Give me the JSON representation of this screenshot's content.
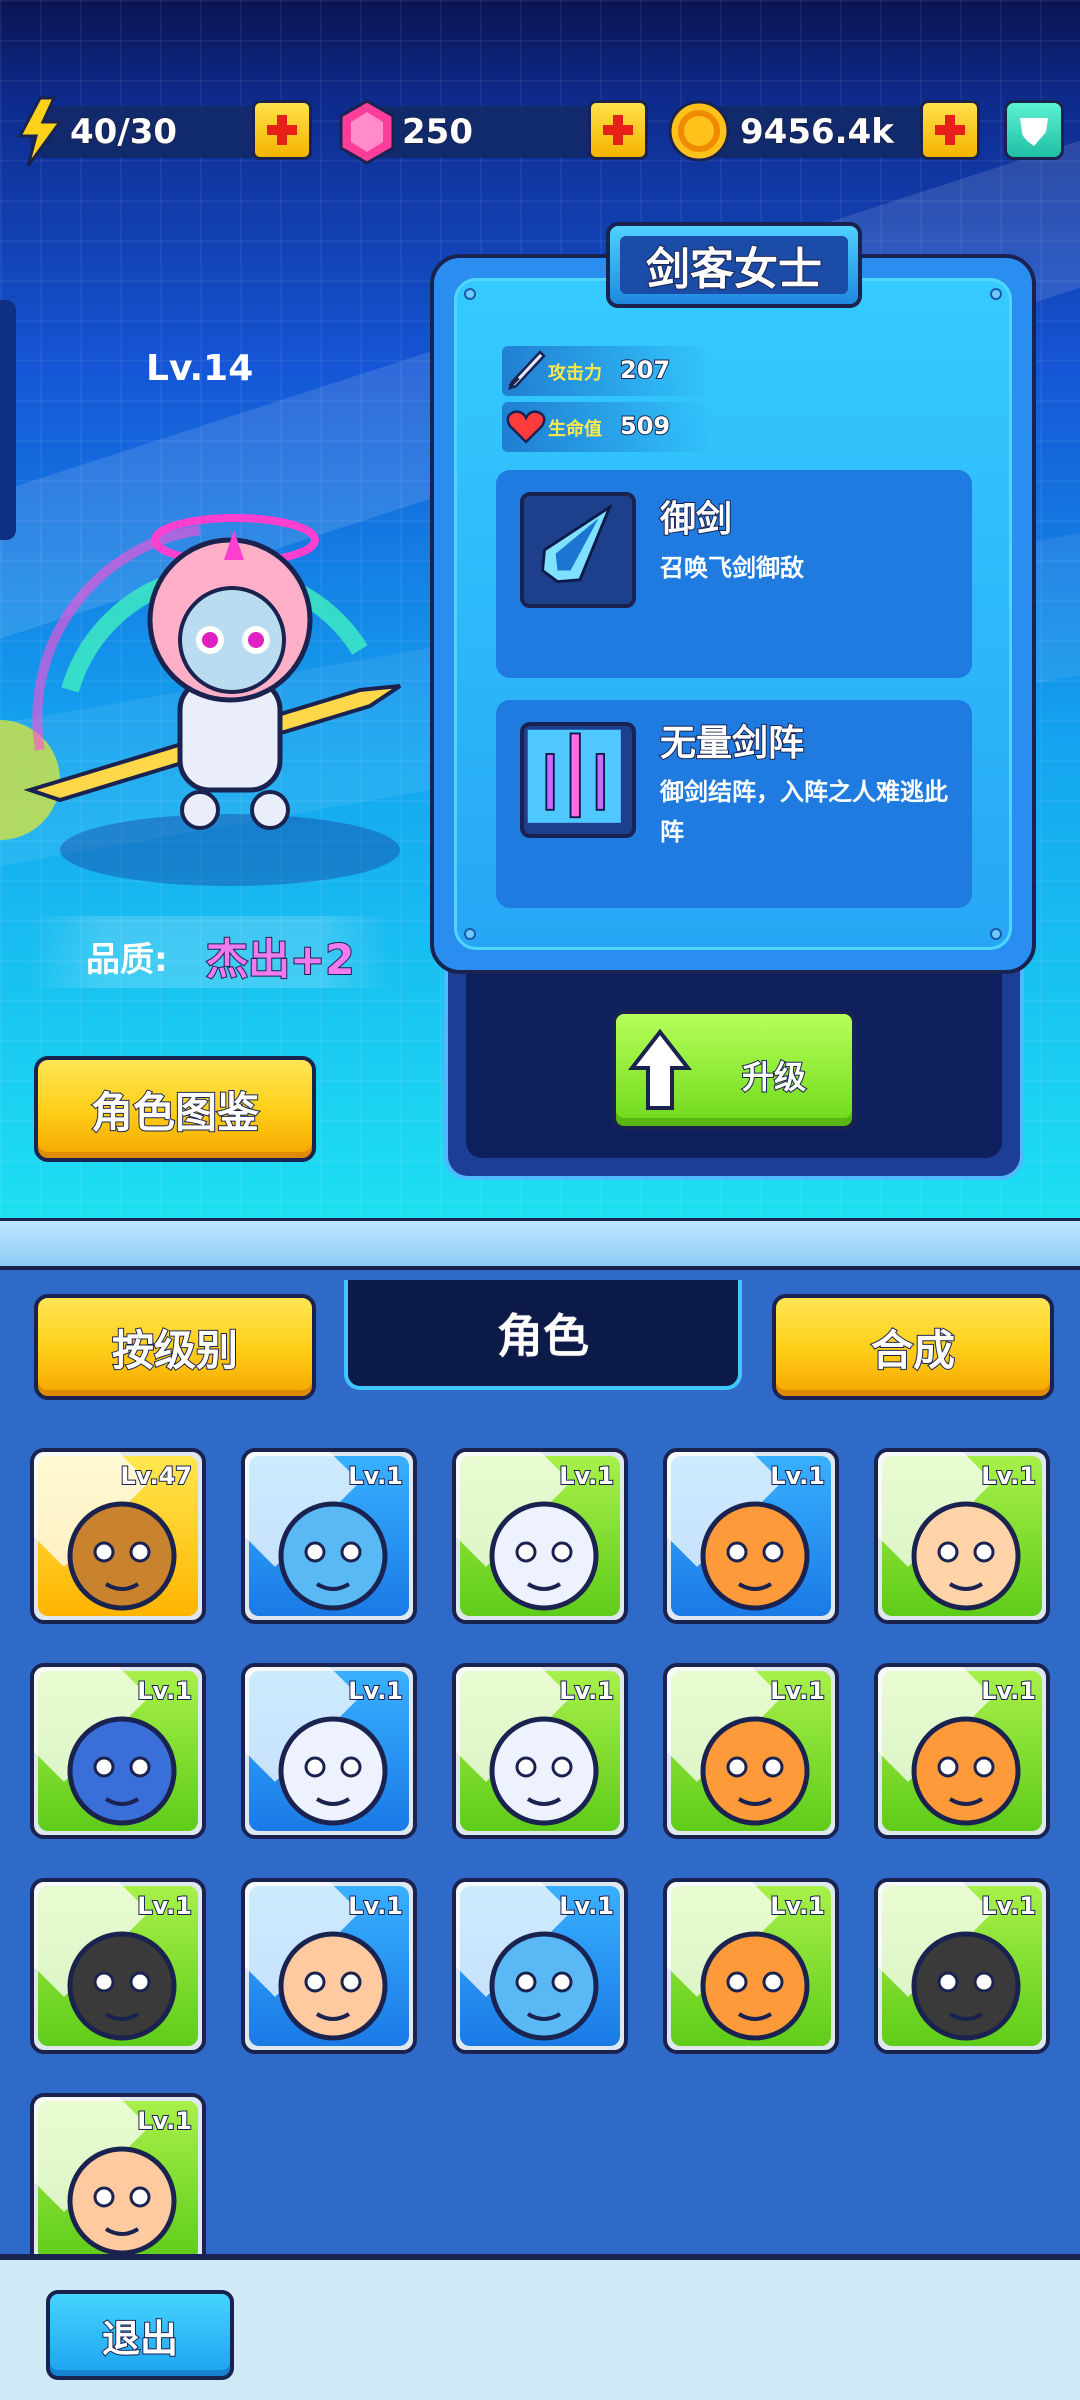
{
  "colors": {
    "accent_yellow": "#ffd01a",
    "accent_green": "#8ef02e",
    "quality_pink": "#f07af0",
    "panel_blue": "#2a8ef0",
    "outline": "#1a2350"
  },
  "resources": {
    "energy": {
      "icon": "lightning-icon",
      "value": "40/30"
    },
    "gems": {
      "icon": "gem-icon",
      "value": "250"
    },
    "coins": {
      "icon": "coin-icon",
      "value": "9456.4k"
    },
    "shield_icon": "shield-icon"
  },
  "character": {
    "level": "Lv.14",
    "name": "剑客女士",
    "quality_label": "品质:",
    "quality_value": "杰出+2",
    "stats": {
      "attack": {
        "label": "攻击力",
        "value": "207"
      },
      "hp": {
        "label": "生命值",
        "value": "509"
      }
    },
    "skills": [
      {
        "name": "御剑",
        "desc": "召唤飞剑御敌"
      },
      {
        "name": "无量剑阵",
        "desc": "御剑结阵，入阵之人难逃此阵"
      }
    ]
  },
  "buttons": {
    "codex": "角色图鉴",
    "upgrade": "升级",
    "sort": "按级别",
    "merge": "合成",
    "exit": "退出"
  },
  "tabs": {
    "active": "角色"
  },
  "roster": [
    {
      "level": "Lv.47",
      "hero": "monkey",
      "bg": "gold",
      "selected": true
    },
    {
      "level": "Lv.1",
      "hero": "blue-squid",
      "bg": "blue"
    },
    {
      "level": "Lv.1",
      "hero": "white-hair-goggles",
      "bg": "green"
    },
    {
      "level": "Lv.1",
      "hero": "orange-bun-girl",
      "bg": "blue"
    },
    {
      "level": "Lv.1",
      "hero": "round-face-man",
      "bg": "green"
    },
    {
      "level": "Lv.1",
      "hero": "blue-hood-girl",
      "bg": "green"
    },
    {
      "level": "Lv.1",
      "hero": "white-hair-goggles",
      "bg": "blue"
    },
    {
      "level": "Lv.1",
      "hero": "white-hair-goggles",
      "bg": "green"
    },
    {
      "level": "Lv.1",
      "hero": "bearded-king",
      "bg": "green"
    },
    {
      "level": "Lv.1",
      "hero": "orange-bun-girl",
      "bg": "green"
    },
    {
      "level": "Lv.1",
      "hero": "bearded-bandana",
      "bg": "green"
    },
    {
      "level": "Lv.1",
      "hero": "monocle-gentleman",
      "bg": "blue"
    },
    {
      "level": "Lv.1",
      "hero": "blue-squid",
      "bg": "blue"
    },
    {
      "level": "Lv.1",
      "hero": "orange-bun-girl",
      "bg": "green"
    },
    {
      "level": "Lv.1",
      "hero": "bearded-bandana",
      "bg": "green"
    },
    {
      "level": "Lv.1",
      "hero": "monocle-gentleman",
      "bg": "green"
    }
  ]
}
